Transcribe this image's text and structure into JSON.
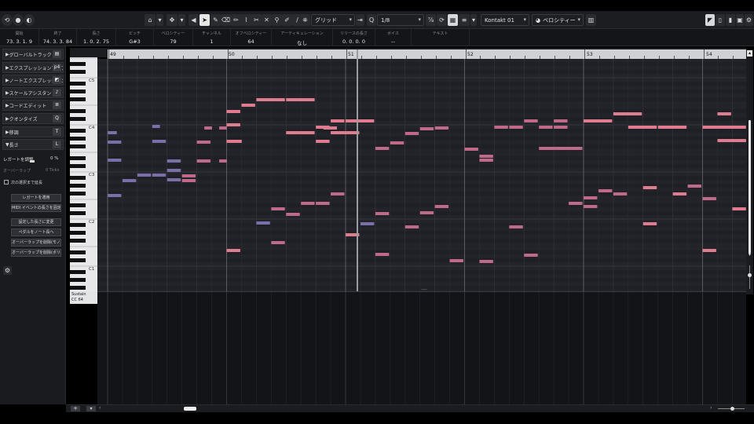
{
  "toolbar": {
    "grid_type": "グリッド",
    "quantize": "1/8",
    "instrument": "Kontakt 01",
    "note_color": "ベロシティー",
    "icons": [
      "loop-icon",
      "record-icon",
      "monitor-icon",
      "camera-icon",
      "tool-icon",
      "speaker-icon",
      "arrow-icon",
      "pencil-icon",
      "eraser-icon",
      "brush-icon",
      "scissors-icon",
      "glue-icon",
      "mute-icon",
      "zoom-icon",
      "line-icon",
      "snap-icon",
      "quantize-icon",
      "panel-icon",
      "keyboard-icon"
    ]
  },
  "info": {
    "start_label": "開始",
    "start_value": "73. 3. 1.  9",
    "end_label": "終了",
    "end_value": "74. 3. 3. 84",
    "length_label": "長さ",
    "length_value": "1. 0. 2. 75",
    "pitch_label": "ピッチ",
    "pitch_value": "G#3",
    "velocity_label": "ベロシティー",
    "velocity_value": "79",
    "channel_label": "チャンネル",
    "channel_value": "1",
    "off_velocity_label": "オフベロシティー",
    "off_velocity_value": "64",
    "articulation_label": "アーティキュレーション",
    "articulation_value": "なし",
    "release_label": "リリースの長さ",
    "release_value": "0. 0. 0.  0",
    "voice_label": "ボイス",
    "voice_value": "--",
    "text_label": "テキスト",
    "text_value": ""
  },
  "sections": [
    {
      "label": "グローバルトラック",
      "icon": "▤"
    },
    {
      "label": "エクスプレッションマップ",
      "icon": "p4"
    },
    {
      "label": "ノートエクスプレッション",
      "icon": "◩"
    },
    {
      "label": "スケールアシスタント",
      "icon": "♪"
    },
    {
      "label": "コードエディット",
      "icon": "≣"
    },
    {
      "label": "クオンタイズ",
      "icon": "Q"
    },
    {
      "label": "移調",
      "icon": "T"
    },
    {
      "label": "長さ",
      "icon": "L"
    }
  ],
  "length_panel": {
    "legato_label": "レガートを調整",
    "legato_value": "0 %",
    "overlap_label": "オーバーラップ",
    "overlap_value": "0 Ticks",
    "extend_label": "次の選択まで延長",
    "buttons": [
      "レガートを適用",
      "MIDI イベントの長さを固定",
      "設定した長さに変更",
      "ペダルをノート長へ",
      "オーバーラップを削除(モノ)",
      "オーバーラップを削除(ポリ)"
    ]
  },
  "ruler": {
    "bars": [
      "49",
      "50",
      "51",
      "52",
      "53",
      "54"
    ],
    "playhead": "51"
  },
  "keyboard": {
    "labels": [
      "C5",
      "C4",
      "C3",
      "C2",
      "C1"
    ]
  },
  "controller": {
    "name": "Sustain",
    "cc": "CC 64"
  },
  "note_colors": {
    "high": "#e07c8f",
    "mid": "#c06a8a",
    "low": "#7a6fa8",
    "lowest": "#5c6aa8"
  }
}
